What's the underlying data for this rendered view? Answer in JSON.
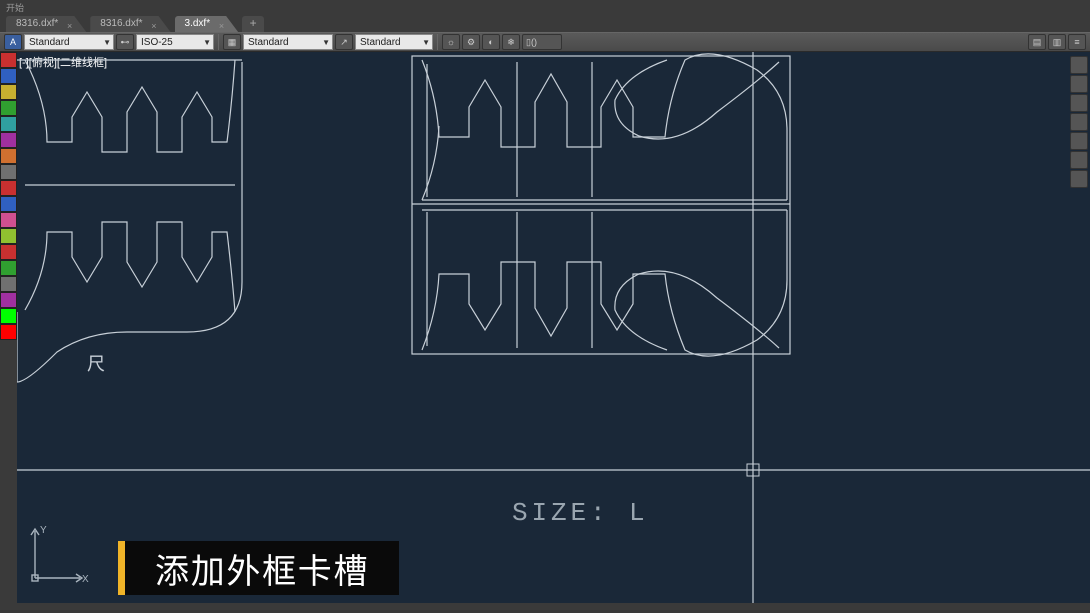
{
  "menu": {
    "item0": "开始"
  },
  "tabs": {
    "t0": "8316.dxf*",
    "t1": "8316.dxf*",
    "t2": "3.dxf*"
  },
  "ribbon": {
    "text_style": "Standard",
    "dim_style": "ISO-25",
    "table_style": "Standard",
    "mleader_style": "Standard",
    "a_icon": "A"
  },
  "model_tab": "[-][俯视][二维线框]",
  "drawing": {
    "size_label": "SIZE: L",
    "annot": "尺"
  },
  "caption": "添加外框卡槽",
  "ucs": {
    "x": "X",
    "y": "Y"
  }
}
